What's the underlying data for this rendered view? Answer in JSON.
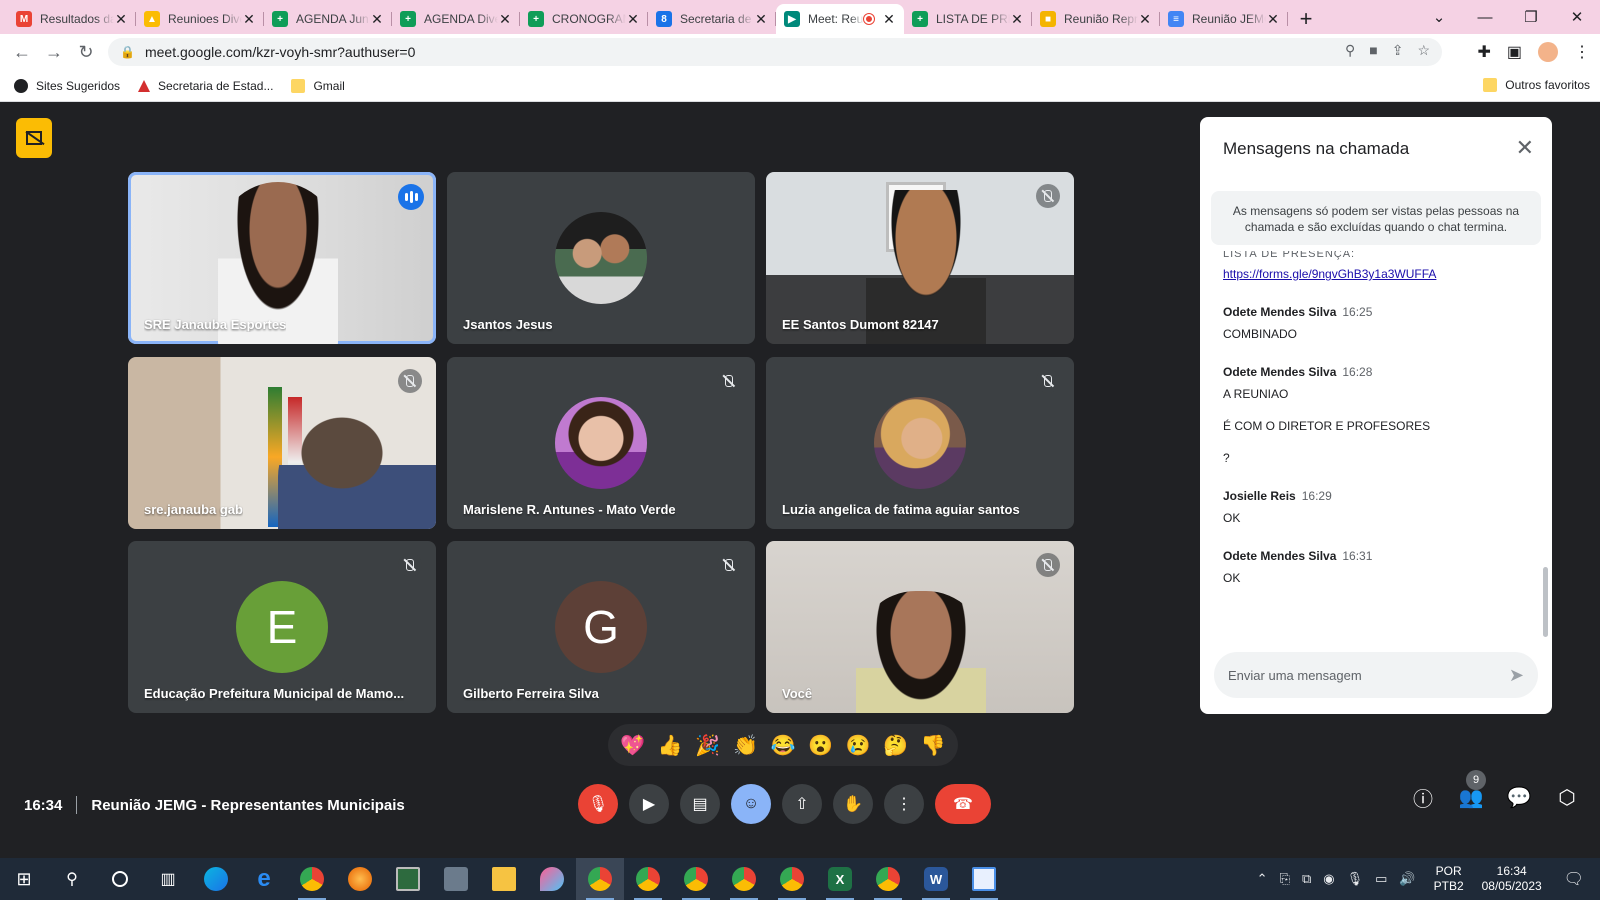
{
  "browser": {
    "tabs": [
      {
        "title": "Resultados da pesquisa",
        "color": "#ea4335",
        "letter": "M"
      },
      {
        "title": "Reunioes Diversas",
        "color": "#fbbc04",
        "letter": "▲"
      },
      {
        "title": "AGENDA Junho",
        "color": "#0f9d58",
        "letter": "+"
      },
      {
        "title": "AGENDA Diversa",
        "color": "#0f9d58",
        "letter": "+"
      },
      {
        "title": "CRONOGRAMA",
        "color": "#0f9d58",
        "letter": "+"
      },
      {
        "title": "Secretaria de Estado",
        "color": "#1a73e8",
        "letter": "8"
      },
      {
        "title": "Meet: Reunião",
        "color": "#00897b",
        "letter": "▶",
        "active": true
      },
      {
        "title": "LISTA DE PRESENÇA",
        "color": "#0f9d58",
        "letter": "+"
      },
      {
        "title": "Reunião Representantes",
        "color": "#f4b400",
        "letter": "■"
      },
      {
        "title": "Reunião JEMG",
        "color": "#4285f4",
        "letter": "≡"
      }
    ],
    "new_tab": "+",
    "url": "meet.google.com/kzr-voyh-smr?authuser=0",
    "bookmarks": [
      {
        "label": "Sites Sugeridos"
      },
      {
        "label": "Secretaria de Estad..."
      },
      {
        "label": "Gmail"
      }
    ],
    "other_bookmarks": "Outros favoritos"
  },
  "meet": {
    "participants": [
      {
        "name": "SRE Janauba Esportes",
        "speaking": true
      },
      {
        "name": "Jsantos Jesus"
      },
      {
        "name": "EE Santos Dumont 82147"
      },
      {
        "name": "sre.janauba gab"
      },
      {
        "name": "Marislene R. Antunes - Mato Verde"
      },
      {
        "name": "Luzia angelica de fatima aguiar santos"
      },
      {
        "name": "Educação Prefeitura Municipal de Mamo...",
        "initial": "E",
        "color": "#689f38"
      },
      {
        "name": "Gilberto Ferreira Silva",
        "initial": "G",
        "color": "#5d4037"
      },
      {
        "name": "Você"
      }
    ],
    "reactions": [
      "💖",
      "👍",
      "🎉",
      "👏",
      "😂",
      "😮",
      "😢",
      "🤔",
      "👎"
    ],
    "time": "16:34",
    "meeting_title": "Reunião JEMG - Representantes Municipais",
    "people_count": "9"
  },
  "chat": {
    "title": "Mensagens na chamada",
    "notice": "As mensagens só podem ser vistas pelas pessoas na chamada e são excluídas quando o chat termina.",
    "cut_text": "LISTA DE PRESENÇA:",
    "link": "https://forms.gle/9ngvGhB3y1a3WUFFA",
    "messages": [
      {
        "author": "Odete Mendes Silva",
        "time": "16:25",
        "lines": [
          "COMBINADO"
        ]
      },
      {
        "author": "Odete Mendes Silva",
        "time": "16:28",
        "lines": [
          "A REUNIAO",
          "É COM O DIRETOR E PROFESORES",
          "?"
        ]
      },
      {
        "author": "Josielle Reis",
        "time": "16:29",
        "lines": [
          "OK"
        ]
      },
      {
        "author": "Odete Mendes Silva",
        "time": "16:31",
        "lines": [
          "OK"
        ]
      }
    ],
    "placeholder": "Enviar uma mensagem"
  },
  "taskbar": {
    "lang1": "POR",
    "lang2": "PTB2",
    "time": "16:34",
    "date": "08/05/2023"
  }
}
